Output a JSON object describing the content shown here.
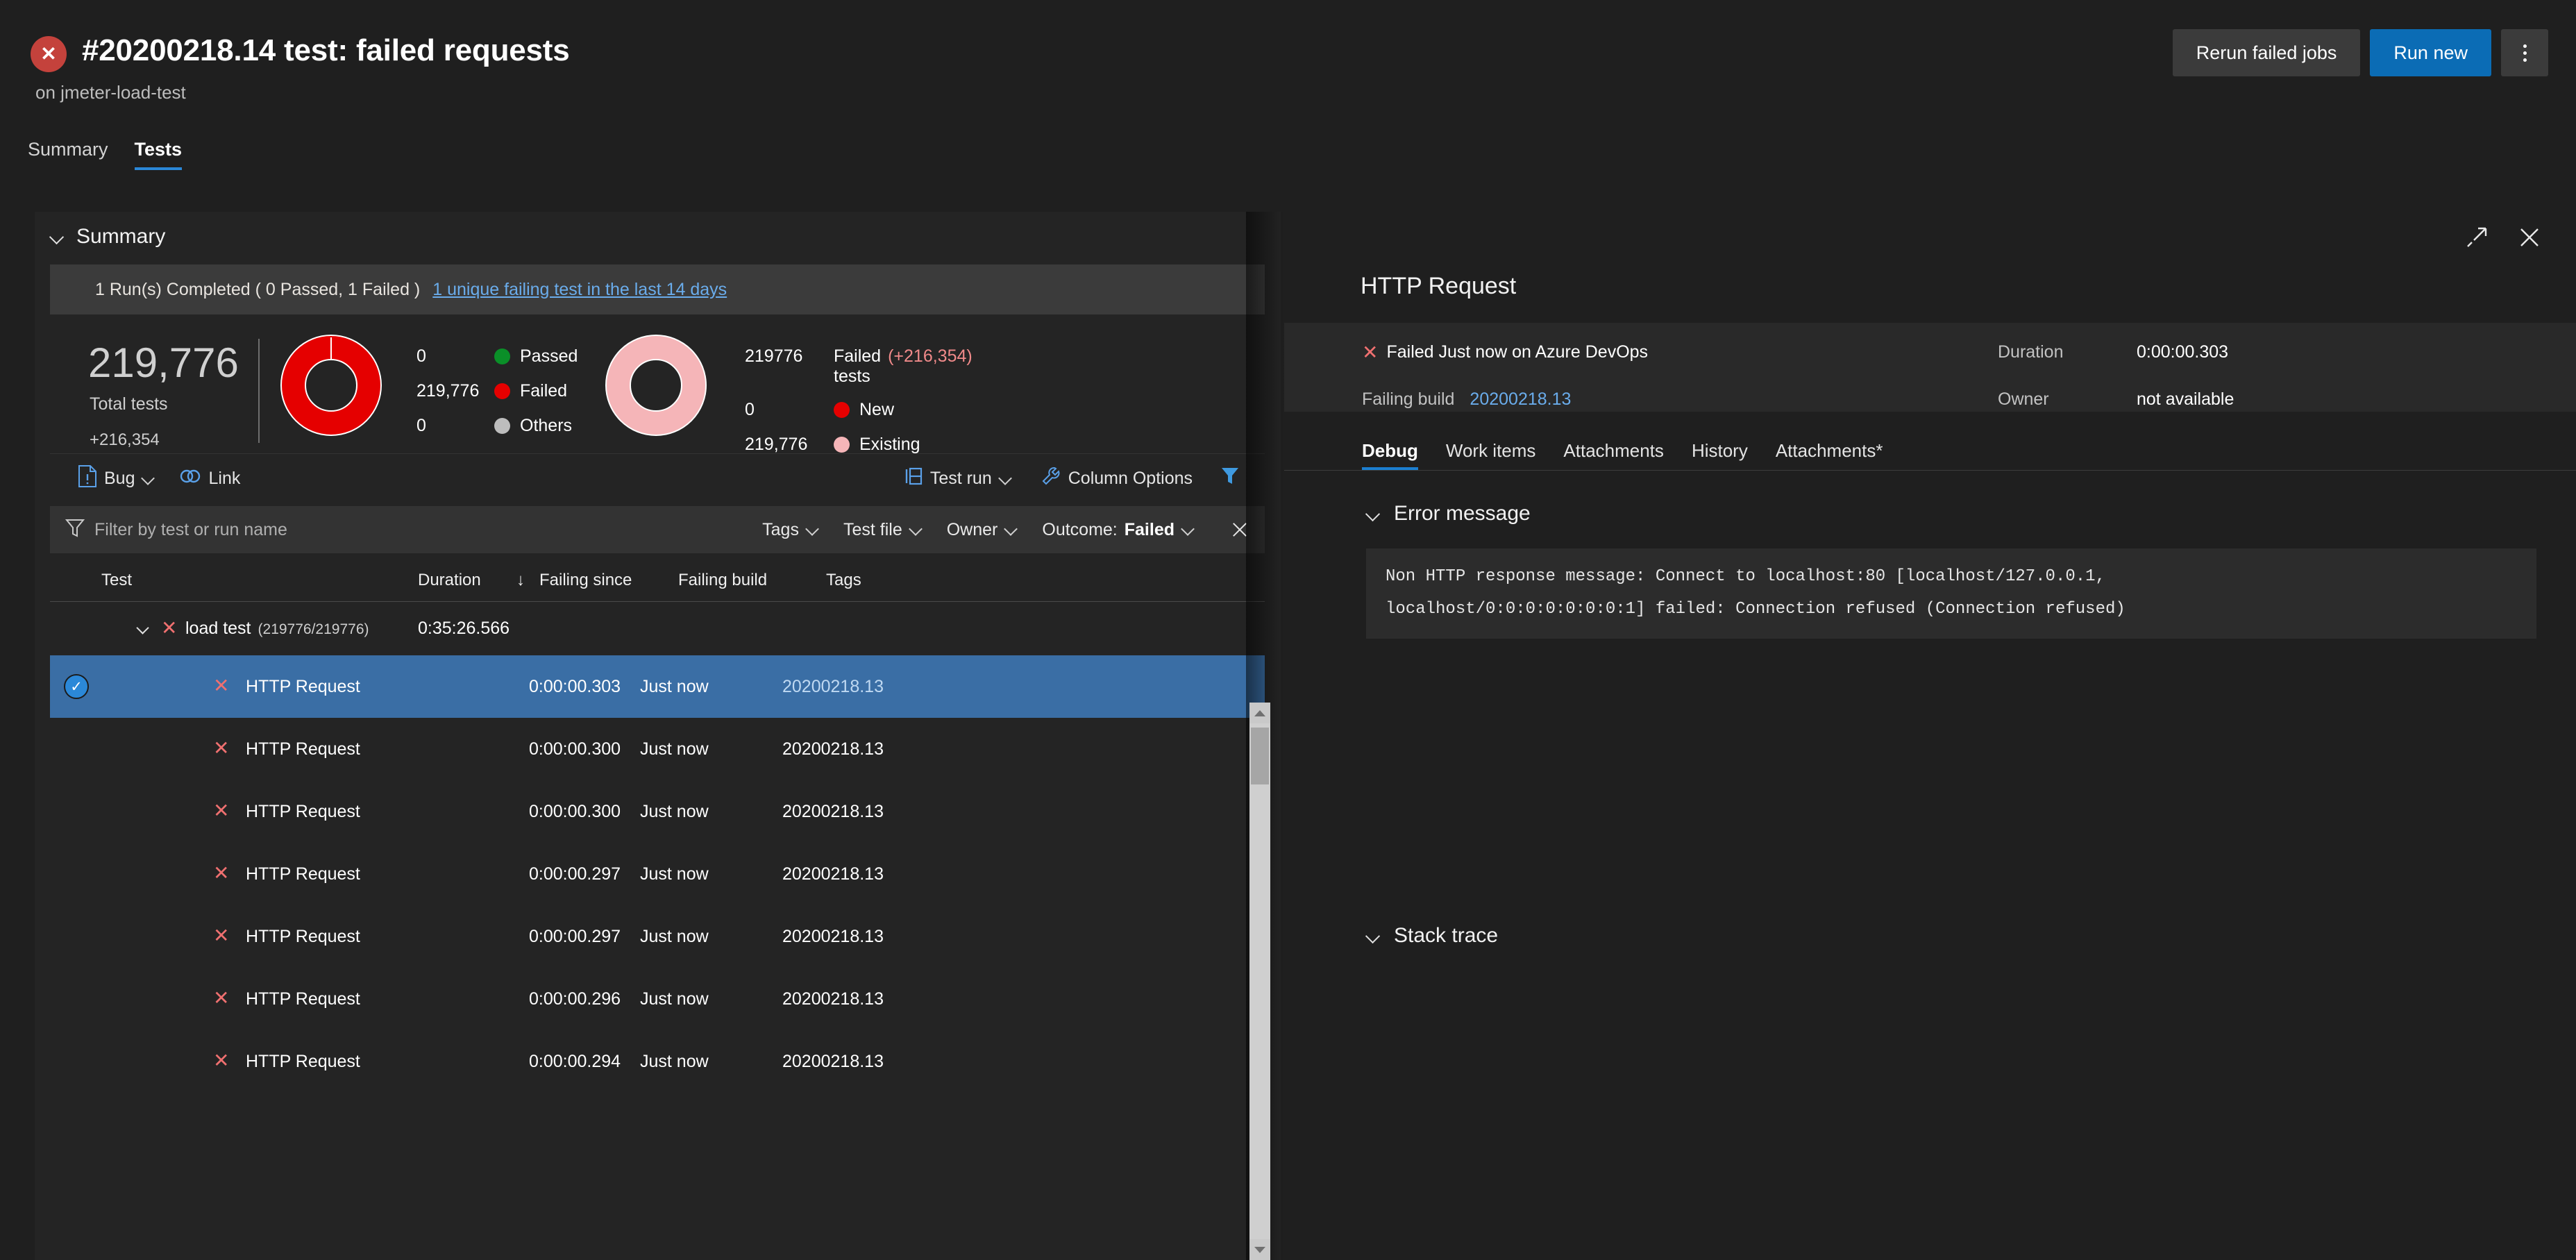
{
  "header": {
    "status_icon": "failed-x-icon",
    "title": "#20200218.14 test: failed requests",
    "subtitle": "on jmeter-load-test",
    "rerun_label": "Rerun failed jobs",
    "run_new_label": "Run new",
    "more_label": "More actions"
  },
  "tabs": [
    {
      "label": "Summary",
      "active": false
    },
    {
      "label": "Tests",
      "active": true
    }
  ],
  "summary": {
    "section_title": "Summary",
    "run_text": "1 Run(s) Completed ( 0 Passed, 1 Failed )",
    "run_link": "1 unique failing test in the last 14 days",
    "total_value": "219,776",
    "total_label": "Total tests",
    "total_delta": "+216,354",
    "outcome_legend": [
      {
        "value": "0",
        "label": "Passed",
        "color": "#0a8f28"
      },
      {
        "value": "219,776",
        "label": "Failed",
        "color": "#e50000"
      },
      {
        "value": "0",
        "label": "Others",
        "color": "#bdbdbd"
      }
    ],
    "failed_header_value": "219776",
    "failed_header_label": "Failed",
    "failed_header_delta": "(+216,354)",
    "failed_header_sub": "tests",
    "failed_legend": [
      {
        "value": "0",
        "label": "New",
        "color": "#e50000"
      },
      {
        "value": "219,776",
        "label": "Existing",
        "color": "#f5b5b8"
      }
    ]
  },
  "toolbar": {
    "bug_label": "Bug",
    "link_label": "Link",
    "test_run_label": "Test run",
    "column_options_label": "Column Options",
    "filter_toggle": "filter-funnel-icon"
  },
  "filterbar": {
    "placeholder": "Filter by test or run name",
    "value": "",
    "pills": [
      {
        "label": "Tags",
        "value": ""
      },
      {
        "label": "Test file",
        "value": ""
      },
      {
        "label": "Owner",
        "value": ""
      },
      {
        "label": "Outcome:",
        "value": "Failed"
      }
    ],
    "clear_label": "Clear filters"
  },
  "table": {
    "columns": [
      "Test",
      "Duration",
      "Failing since",
      "Failing build",
      "Tags"
    ],
    "sort_column": "Duration",
    "sort_direction": "desc",
    "group_row": {
      "name": "load test",
      "count": "(219776/219776)",
      "duration": "0:35:26.566"
    },
    "rows": [
      {
        "test": "HTTP Request",
        "duration": "0:00:00.303",
        "failing_since": "Just now",
        "failing_build": "20200218.13",
        "tags": "",
        "selected": true
      },
      {
        "test": "HTTP Request",
        "duration": "0:00:00.300",
        "failing_since": "Just now",
        "failing_build": "20200218.13",
        "tags": "",
        "selected": false
      },
      {
        "test": "HTTP Request",
        "duration": "0:00:00.300",
        "failing_since": "Just now",
        "failing_build": "20200218.13",
        "tags": "",
        "selected": false
      },
      {
        "test": "HTTP Request",
        "duration": "0:00:00.297",
        "failing_since": "Just now",
        "failing_build": "20200218.13",
        "tags": "",
        "selected": false
      },
      {
        "test": "HTTP Request",
        "duration": "0:00:00.297",
        "failing_since": "Just now",
        "failing_build": "20200218.13",
        "tags": "",
        "selected": false
      },
      {
        "test": "HTTP Request",
        "duration": "0:00:00.296",
        "failing_since": "Just now",
        "failing_build": "20200218.13",
        "tags": "",
        "selected": false
      },
      {
        "test": "HTTP Request",
        "duration": "0:00:00.294",
        "failing_since": "Just now",
        "failing_build": "20200218.13",
        "tags": "",
        "selected": false
      }
    ]
  },
  "detail": {
    "title": "HTTP Request",
    "status_text": "Failed Just now on Azure DevOps",
    "failing_build_key": "Failing build",
    "failing_build_value": "20200218.13",
    "duration_key": "Duration",
    "duration_value": "0:00:00.303",
    "owner_key": "Owner",
    "owner_value": "not available",
    "tabs": [
      {
        "label": "Debug",
        "active": true
      },
      {
        "label": "Work items",
        "active": false
      },
      {
        "label": "Attachments",
        "active": false
      },
      {
        "label": "History",
        "active": false
      },
      {
        "label": "Attachments*",
        "active": false
      }
    ],
    "error_section_title": "Error message",
    "error_line1": "Non HTTP response message: Connect to localhost:80 [localhost/127.0.0.1,",
    "error_line2": "localhost/0:0:0:0:0:0:0:1] failed: Connection refused (Connection refused)",
    "stack_section_title": "Stack trace",
    "expand_icon": "expand-icon",
    "close_icon": "close-icon"
  },
  "colors": {
    "accent": "#0b6cb5",
    "failed": "#e50000",
    "passed": "#0a8f28",
    "others": "#bdbdbd",
    "existing": "#f5b5b8",
    "link": "#6aaceb",
    "selected_row": "#3a6ea5"
  }
}
